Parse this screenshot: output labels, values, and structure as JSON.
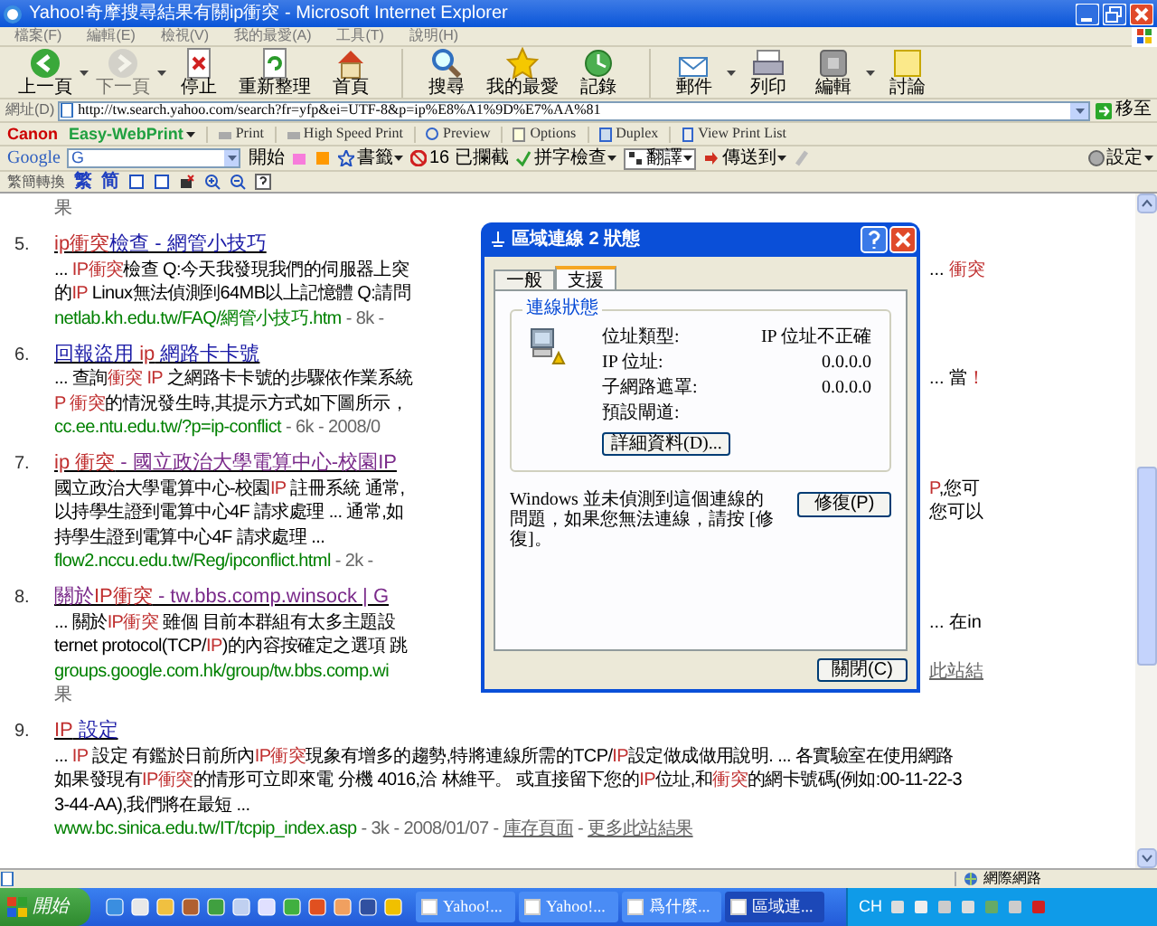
{
  "window": {
    "title": "Yahoo!奇摩搜尋結果有關ip衝突 - Microsoft Internet Explorer"
  },
  "menu": [
    "檔案(F)",
    "編輯(E)",
    "檢視(V)",
    "我的最愛(A)",
    "工具(T)",
    "說明(H)"
  ],
  "toolbar": [
    {
      "label": "上一頁",
      "disabled": false,
      "dropdown": true
    },
    {
      "label": "下一頁",
      "disabled": true,
      "dropdown": true
    },
    {
      "label": "停止",
      "disabled": false,
      "dropdown": false
    },
    {
      "label": "重新整理",
      "disabled": false,
      "dropdown": false
    },
    {
      "label": "首頁",
      "disabled": false,
      "dropdown": false
    },
    {
      "label": "搜尋",
      "disabled": false,
      "dropdown": false
    },
    {
      "label": "我的最愛",
      "disabled": false,
      "dropdown": false
    },
    {
      "label": "記錄",
      "disabled": false,
      "dropdown": false
    },
    {
      "label": "郵件",
      "disabled": false,
      "dropdown": true
    },
    {
      "label": "列印",
      "disabled": false,
      "dropdown": false
    },
    {
      "label": "編輯",
      "disabled": false,
      "dropdown": true
    },
    {
      "label": "討論",
      "disabled": false,
      "dropdown": false
    }
  ],
  "address_bar": {
    "label": "網址(D)",
    "value": "http://tw.search.yahoo.com/search?fr=yfp&ei=UTF-8&p=ip%E8%A1%9D%E7%AA%81",
    "go": "移至"
  },
  "print_toolbar": {
    "brand": "Canon",
    "product": "Easy-WebPrint",
    "items": [
      "Print",
      "High Speed Print",
      "Preview",
      "Options",
      "Duplex",
      "View Print List"
    ]
  },
  "google_toolbar": {
    "logo": "Google",
    "field_prefix": "G",
    "search": "開始",
    "bookmarks": "書籤",
    "blocked": "16 已攔截",
    "spellcheck": "拼字檢查",
    "translate": "翻譯",
    "send_to": "傳送到",
    "settings": "設定"
  },
  "conversion_toolbar": {
    "label": "繁簡轉換",
    "traditional": "繁",
    "simplified": "简"
  },
  "results": {
    "leading_fragment": "果",
    "items": [
      {
        "number": "5.",
        "visited": false,
        "title": [
          {
            "kind": "hit",
            "text": "ip衝突"
          },
          {
            "kind": "title",
            "text": "檢查 - 網管小技巧"
          }
        ],
        "lines": [
          {
            "left": [
              {
                "kind": "plain",
                "text": "... "
              },
              {
                "kind": "hit",
                "text": "IP衝突"
              },
              {
                "kind": "plain",
                "text": "檢查 Q:今天我發現我們的伺服器上突"
              }
            ],
            "right": [
              {
                "kind": "plain",
                "text": "... "
              },
              {
                "kind": "hit",
                "text": "衝突"
              }
            ]
          },
          {
            "left": [
              {
                "kind": "plain",
                "text": "的"
              },
              {
                "kind": "hit",
                "text": "IP"
              },
              {
                "kind": "plain",
                "text": " Linux無法偵測到64MB以上記憶體 Q:請問"
              }
            ]
          },
          {
            "left": [
              {
                "kind": "url",
                "text": "netlab.kh.edu.tw/FAQ/網管小技巧.htm"
              },
              {
                "kind": "meta",
                "text": " - 8k -"
              }
            ]
          }
        ]
      },
      {
        "number": "6.",
        "visited": false,
        "title": [
          {
            "kind": "title",
            "text": "回報盜用 "
          },
          {
            "kind": "hit",
            "text": "ip"
          },
          {
            "kind": "title",
            "text": " 網路卡卡號"
          }
        ],
        "lines": [
          {
            "left": [
              {
                "kind": "plain",
                "text": "... 查詢"
              },
              {
                "kind": "hit",
                "text": "衝突 IP"
              },
              {
                "kind": "plain",
                "text": " 之網路卡卡號的步驟依作業系統"
              }
            ],
            "right": [
              {
                "kind": "plain",
                "text": "... 當"
              },
              {
                "kind": "hit",
                "text": "！"
              }
            ]
          },
          {
            "left": [
              {
                "kind": "hit",
                "text": "P 衝突"
              },
              {
                "kind": "plain",
                "text": "的情況發生時,其提示方式如下圖所示，"
              }
            ]
          },
          {
            "left": [
              {
                "kind": "url",
                "text": "cc.ee.ntu.edu.tw/?p=ip-conflict"
              },
              {
                "kind": "meta",
                "text": " - 6k - 2008/0"
              }
            ]
          }
        ]
      },
      {
        "number": "7.",
        "visited": true,
        "title": [
          {
            "kind": "hit",
            "text": "ip 衝突"
          },
          {
            "kind": "title",
            "text": " - 國立政治大學電算中心-校園IP"
          }
        ],
        "lines": [
          {
            "left": [
              {
                "kind": "plain",
                "text": "國立政治大學電算中心-校園"
              },
              {
                "kind": "hit",
                "text": "IP"
              },
              {
                "kind": "plain",
                "text": " 註冊系統 通常,"
              }
            ],
            "right": [
              {
                "kind": "hit",
                "text": "P"
              },
              {
                "kind": "plain",
                "text": ",您可"
              }
            ]
          },
          {
            "left": [
              {
                "kind": "plain",
                "text": "以持學生證到電算中心4F 請求處理 ... 通常,如"
              }
            ],
            "right": [
              {
                "kind": "plain",
                "text": "您可以"
              }
            ]
          },
          {
            "left": [
              {
                "kind": "plain",
                "text": "持學生證到電算中心4F 請求處理 ..."
              }
            ]
          },
          {
            "left": [
              {
                "kind": "url",
                "text": "flow2.nccu.edu.tw/Reg/ipconflict.html"
              },
              {
                "kind": "meta",
                "text": " - 2k -"
              }
            ]
          }
        ]
      },
      {
        "number": "8.",
        "visited": true,
        "title": [
          {
            "kind": "title",
            "text": "關於"
          },
          {
            "kind": "hit",
            "text": "IP衝突"
          },
          {
            "kind": "title",
            "text": " - tw.bbs.comp.winsock | G"
          }
        ],
        "lines": [
          {
            "left": [
              {
                "kind": "plain",
                "text": "... 關於"
              },
              {
                "kind": "hit",
                "text": "IP衝突"
              },
              {
                "kind": "plain",
                "text": " 雖個 目前本群組有太多主題設"
              }
            ],
            "right": [
              {
                "kind": "plain",
                "text": "... 在in"
              }
            ]
          },
          {
            "left": [
              {
                "kind": "plain",
                "text": "ternet protocol(TCP/"
              },
              {
                "kind": "hit",
                "text": "IP"
              },
              {
                "kind": "plain",
                "text": ")的內容按確定之選項 跳"
              }
            ]
          },
          {
            "left": [
              {
                "kind": "url",
                "text": "groups.google.com.hk/group/tw.bbs.comp.wi"
              }
            ],
            "right": [
              {
                "kind": "link",
                "text": "此站結"
              }
            ]
          },
          {
            "left": [
              {
                "kind": "meta",
                "text": "果"
              }
            ]
          }
        ]
      },
      {
        "number": "9.",
        "visited": false,
        "title": [
          {
            "kind": "hit",
            "text": "IP"
          },
          {
            "kind": "title",
            "text": " 設定"
          }
        ],
        "lines": [
          {
            "left": [
              {
                "kind": "plain",
                "text": "... "
              },
              {
                "kind": "hit",
                "text": "IP"
              },
              {
                "kind": "plain",
                "text": " 設定 有鑑於日前所內"
              },
              {
                "kind": "hit",
                "text": "IP衝突"
              },
              {
                "kind": "plain",
                "text": "現象有增多的趨勢,特將連線所需的TCP/"
              },
              {
                "kind": "hit",
                "text": "IP"
              },
              {
                "kind": "plain",
                "text": "設定做成做用說明. ... 各實驗室在使用網路"
              }
            ]
          },
          {
            "left": [
              {
                "kind": "plain",
                "text": "如果發現有"
              },
              {
                "kind": "hit",
                "text": "IP衝突"
              },
              {
                "kind": "plain",
                "text": "的情形可立即來電 分機 4016,洽 林維平。 或直接留下您的"
              },
              {
                "kind": "hit",
                "text": "IP"
              },
              {
                "kind": "plain",
                "text": "位址,和"
              },
              {
                "kind": "hit",
                "text": "衝突"
              },
              {
                "kind": "plain",
                "text": "的網卡號碼(例如:00-11-22-3"
              }
            ]
          },
          {
            "left": [
              {
                "kind": "plain",
                "text": "3-44-AA),我們將在最短 ..."
              }
            ]
          },
          {
            "left": [
              {
                "kind": "url",
                "text": "www.bc.sinica.edu.tw/IT/tcpip_index.asp"
              },
              {
                "kind": "meta",
                "text": " - 3k - 2008/01/07 - "
              },
              {
                "kind": "link",
                "text": "庫存頁面"
              },
              {
                "kind": "meta",
                "text": " - "
              },
              {
                "kind": "link",
                "text": "更多此站結果"
              }
            ]
          }
        ]
      }
    ]
  },
  "dialog": {
    "title": "區域連線 2 狀態",
    "tabs": [
      {
        "label": "一般",
        "selected": false
      },
      {
        "label": "支援",
        "selected": true
      }
    ],
    "group_title": "連線狀態",
    "fields": [
      {
        "label": "位址類型:",
        "value": "IP 位址不正確"
      },
      {
        "label": "IP 位址:",
        "value": "0.0.0.0"
      },
      {
        "label": "子網路遮罩:",
        "value": "0.0.0.0"
      },
      {
        "label": "預設閘道:"
      }
    ],
    "details_button": "詳細資料(D)...",
    "message": "Windows 並未偵測到這個連線的問題，如果您無法連線，請按 [修復]。",
    "repair_button": "修復(P)",
    "close_button": "關閉(C)"
  },
  "status_bar": {
    "zone": "網際網路"
  },
  "taskbar": {
    "start": "開始",
    "tasks": [
      {
        "label": "Yahoo!...",
        "selected": false
      },
      {
        "label": "Yahoo!...",
        "selected": false
      },
      {
        "label": "爲什麼...",
        "selected": false
      },
      {
        "label": "區域連...",
        "selected": true
      }
    ],
    "language": "CH"
  }
}
